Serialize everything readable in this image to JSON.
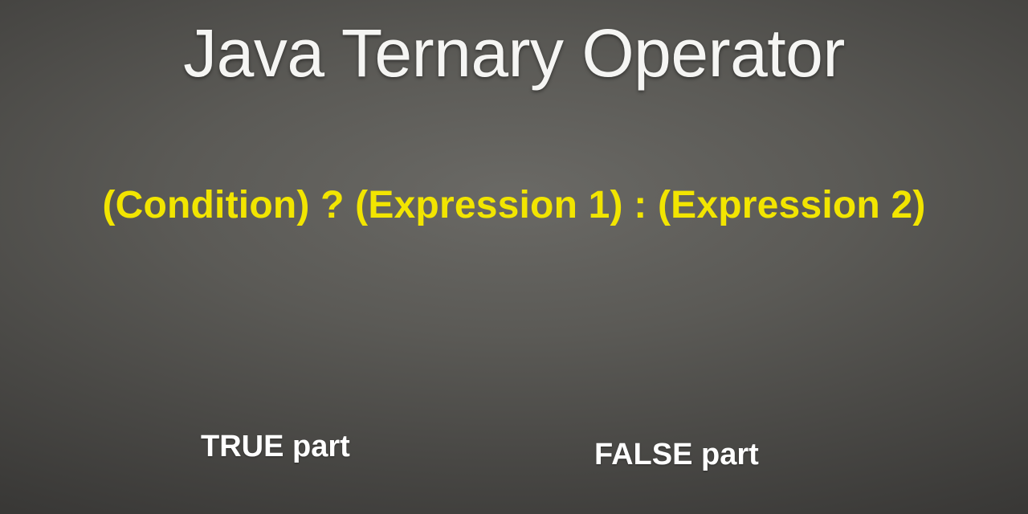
{
  "title": "Java Ternary Operator",
  "syntax": "(Condition) ? (Expression 1) : (Expression 2)",
  "labels": {
    "true_part": "TRUE part",
    "false_part": "FALSE part"
  },
  "colors": {
    "accent_arrow": "#4fb8a0",
    "syntax_text": "#f2e500",
    "title_text": "#f5f5f3",
    "label_text": "#ffffff"
  },
  "icons": {
    "arrow": "ribbon-arrow-icon"
  }
}
